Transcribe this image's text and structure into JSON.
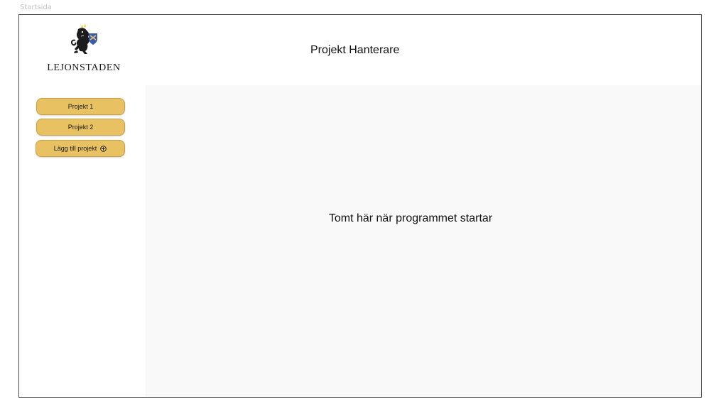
{
  "frame": {
    "label": "Startsida"
  },
  "header": {
    "logo_text": "LEJONSTADEN",
    "title": "Projekt Hanterare",
    "logo_icon": "lion-crest-icon"
  },
  "sidebar": {
    "projects": [
      {
        "label": "Projekt 1"
      },
      {
        "label": "Projekt 2"
      }
    ],
    "add_button": {
      "label": "Lägg till projekt",
      "icon": "add-circle-icon"
    }
  },
  "main": {
    "empty_message": "Tomt här när programmet startar"
  },
  "colors": {
    "button_fill": "#e8c262",
    "button_border": "#c7a24a",
    "main_background": "#f9f9f9",
    "frame_border": "#4a4a4a"
  }
}
